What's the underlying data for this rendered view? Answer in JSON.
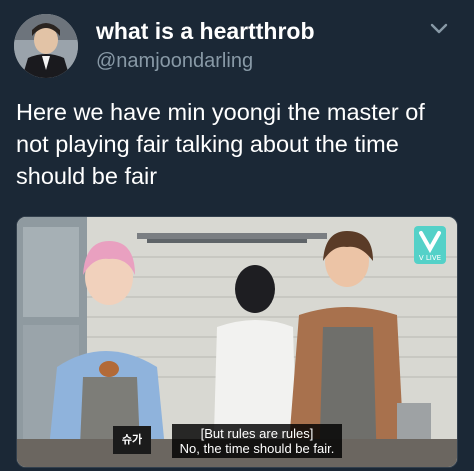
{
  "tweet": {
    "display_name": "what is a heartthrob",
    "handle": "@namjoondarling",
    "text": "Here we have min yoongi the master of\nnot playing fair talking about the time\nshould be fair"
  },
  "media": {
    "logo_text": "V LIVE",
    "name_badge": "슈가",
    "caption_line1": "[But rules are rules]",
    "caption_line2": "No, the time should be fair."
  },
  "icons": {
    "menu": "chevron-down-icon",
    "logo": "vlive-logo-icon"
  },
  "colors": {
    "background": "#1b2836",
    "secondary_text": "#8899a6",
    "primary_text": "#ffffff"
  }
}
